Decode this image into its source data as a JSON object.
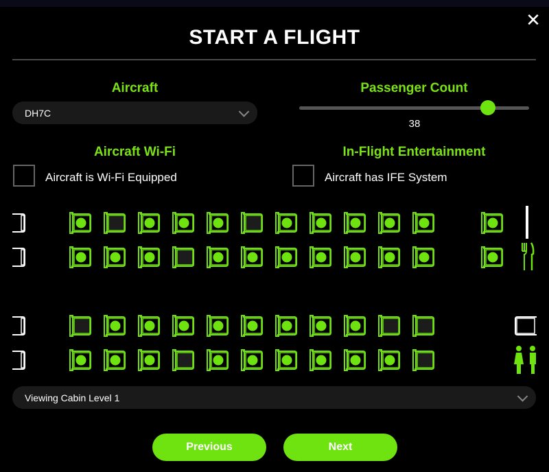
{
  "dialog": {
    "title": "START A FLIGHT",
    "close_symbol": "✕"
  },
  "aircraft": {
    "label": "Aircraft",
    "value": "DH7C"
  },
  "passenger_count": {
    "label": "Passenger Count",
    "value": "38",
    "fraction": 0.82
  },
  "wifi": {
    "label": "Aircraft Wi-Fi",
    "checkbox_label": "Aircraft is Wi-Fi Equipped",
    "checked": false
  },
  "ife": {
    "label": "In-Flight Entertainment",
    "checkbox_label": "Aircraft has IFE System",
    "checked": false
  },
  "seat_map": {
    "rows": [
      [
        true,
        false,
        true,
        true,
        true,
        false,
        true,
        true,
        true,
        true,
        true
      ],
      [
        true,
        true,
        true,
        false,
        true,
        true,
        true,
        true,
        true,
        true,
        true
      ],
      [
        false,
        true,
        true,
        true,
        true,
        true,
        true,
        true,
        true,
        false,
        false
      ],
      [
        true,
        true,
        true,
        false,
        true,
        true,
        true,
        true,
        true,
        true,
        false
      ]
    ],
    "rear_seats": [
      true,
      true
    ],
    "icons": [
      "galley-icon",
      "lavatory-icon"
    ],
    "colors": {
      "seat": "#6ee310",
      "seat_empty_fill": "#1c1c1c",
      "exit": "#ffffff"
    }
  },
  "cabin_level": {
    "value": "Viewing Cabin Level 1"
  },
  "buttons": {
    "previous": "Previous",
    "next": "Next"
  },
  "accent_color": "#6ee310"
}
